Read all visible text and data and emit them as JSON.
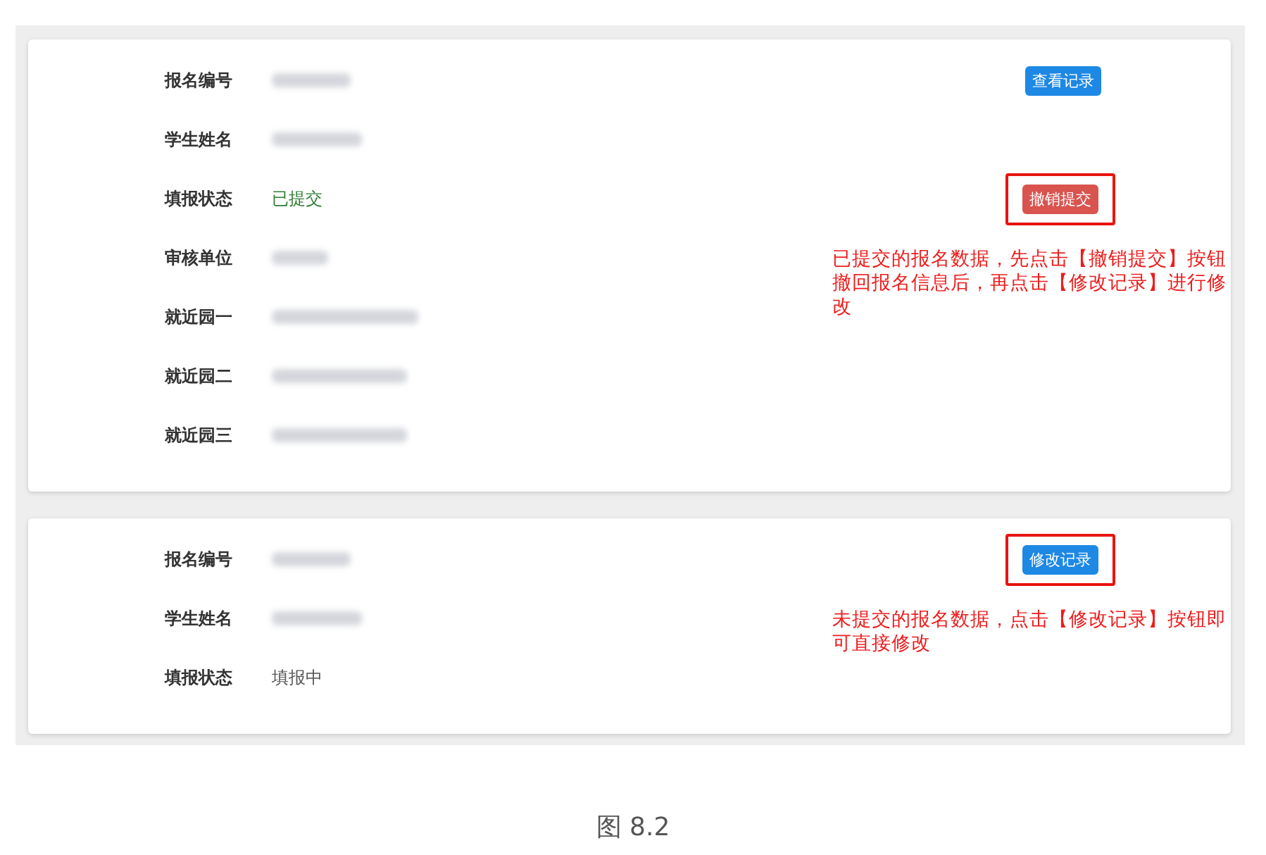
{
  "cards": [
    {
      "fields": [
        {
          "label": "报名编号",
          "kind": "blurred",
          "action": {
            "label": "查看记录",
            "kind": "primary",
            "highlighted": false
          }
        },
        {
          "label": "学生姓名",
          "kind": "blurred"
        },
        {
          "label": "填报状态",
          "kind": "success",
          "value": "已提交",
          "action": {
            "label": "撤销提交",
            "kind": "danger",
            "highlighted": true
          }
        },
        {
          "label": "审核单位",
          "kind": "blurred",
          "note": "已提交的报名数据，先点击【撤销提交】按钮撤回报名信息后，再点击【修改记录】进行修改"
        },
        {
          "label": "就近园一",
          "kind": "blurred"
        },
        {
          "label": "就近园二",
          "kind": "blurred"
        },
        {
          "label": "就近园三",
          "kind": "blurred"
        }
      ]
    },
    {
      "fields": [
        {
          "label": "报名编号",
          "kind": "blurred",
          "action": {
            "label": "修改记录",
            "kind": "primary",
            "highlighted": true
          }
        },
        {
          "label": "学生姓名",
          "kind": "blurred",
          "note": "未提交的报名数据，点击【修改记录】按钮即可直接修改"
        },
        {
          "label": "填报状态",
          "kind": "plain",
          "value": "填报中"
        }
      ]
    }
  ],
  "caption": "图 8.2"
}
